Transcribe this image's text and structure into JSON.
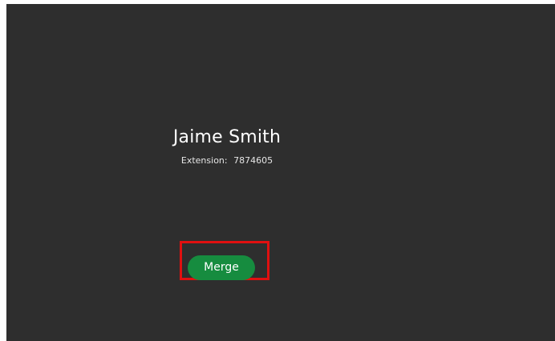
{
  "call": {
    "contact_name": "Jaime Smith",
    "extension_label": "Extension:",
    "extension_value": "7874605"
  },
  "actions": {
    "merge_label": "Merge"
  },
  "colors": {
    "background": "#2e2e2e",
    "merge_button": "#168c3f",
    "highlight": "#e01010"
  }
}
